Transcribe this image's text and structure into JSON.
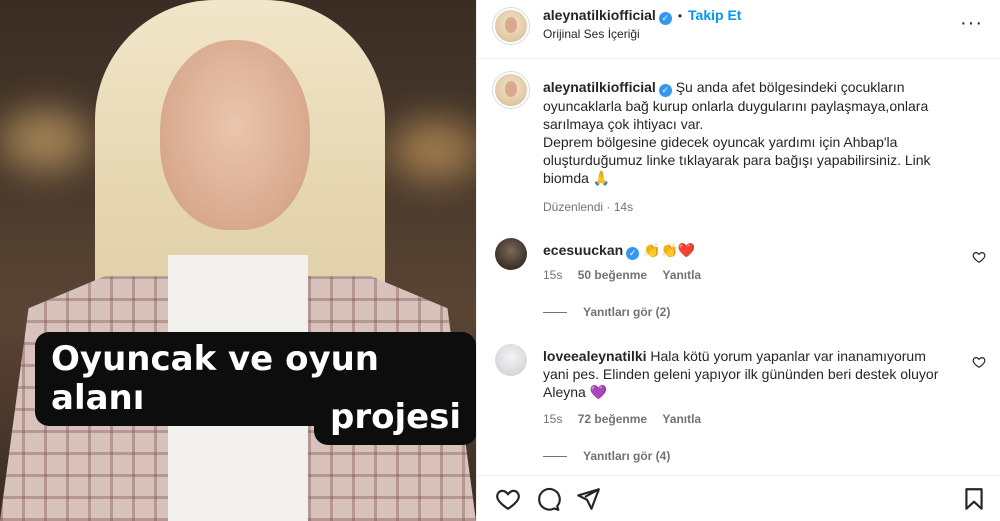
{
  "video": {
    "caption_line1": "Oyuncak ve oyun alanı",
    "caption_line2": "projesi"
  },
  "header": {
    "username": "aleynatilkiofficial",
    "follow_label": "Takip Et",
    "audio_label": "Orijinal Ses İçeriği",
    "more_icon": "more-horizontal-icon"
  },
  "post": {
    "username": "aleynatilkiofficial",
    "caption": "Şu anda afet bölgesindeki çocukların oyuncaklarla bağ kurup onlarla duygularını paylaşmaya,onlara sarılmaya çok ihtiyacı var.",
    "caption2": "Deprem bölgesine gidecek oyuncak yardımı için Ahbap'la oluşturduğumuz linke tıklayarak para bağışı yapabilirsiniz. Link biomda 🙏",
    "edited": "Düzenlendi",
    "time": "14s"
  },
  "comments": [
    {
      "username": "ecesuuckan",
      "text": "👏👏❤️",
      "time": "15s",
      "likes": "50 beğenme",
      "reply_label": "Yanıtla",
      "view_replies": "Yanıtları gör (2)"
    },
    {
      "username": "loveealeynatilki",
      "text": "Hala kötü yorum yapanlar var inanamıyorum yani pes. Elinden geleni yapıyor ilk gününden beri destek oluyor Aleyna 💜",
      "time": "15s",
      "likes": "72 beğenme",
      "reply_label": "Yanıtla",
      "view_replies": "Yanıtları gör (4)"
    }
  ],
  "actions": {
    "like_icon": "heart-icon",
    "comment_icon": "comment-icon",
    "share_icon": "send-icon",
    "save_icon": "bookmark-icon"
  },
  "colors": {
    "link_blue": "#0095f6",
    "verified_blue": "#3797f0",
    "muted": "#737373"
  }
}
